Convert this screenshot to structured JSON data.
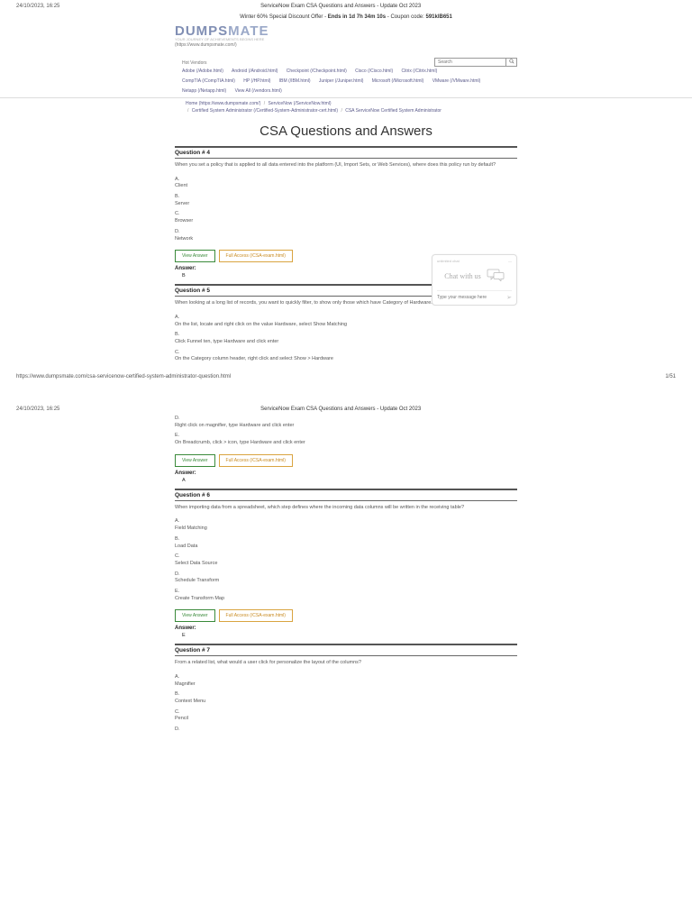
{
  "meta": {
    "datetime": "24/10/2023, 16:25",
    "docTitle": "ServiceNow Exam CSA Questions and Answers - Update Oct 2023",
    "footerUrl": "https://www.dumpsmate.com/csa-servicenow-certified-system-administrator-question.html",
    "footerPage": "1/51"
  },
  "promo": {
    "prefix": "Winter 60% Special Discount Offer - ",
    "endsLabel": "Ends in",
    "countdown": "1d 7h 34m 10s",
    "couponLabel": " - Coupon code: ",
    "coupon": "591klB651"
  },
  "brand": {
    "name1": "DUMPS",
    "name2": "MATE",
    "tagline": "YOUR JOURNEY OF ACHIEVEMENTS BEGINS HERE",
    "url": "(https://www.dumpsmate.com/)"
  },
  "search": {
    "placeholder": "Search"
  },
  "hotVendorsLabel": "Hot Vendors",
  "vendors": {
    "row1": [
      "Adobe (/Adobe.html)",
      "Android (/Android.html)",
      "Checkpoint (/Checkpoint.html)",
      "Cisco (/Cisco.html)",
      "Citrix (/Citrix.html)"
    ],
    "row2": [
      "CompTIA (/CompTIA.html)",
      "HP (/HP.html)",
      "IBM (/IBM.html)",
      "Juniper (/Juniper.html)",
      "Microsoft (/Microsoft.html)",
      "VMware (/VMware.html)"
    ],
    "row3": [
      "Netapp (/Netapp.html)",
      "View All (/vendors.html)"
    ]
  },
  "breadcrumbs": {
    "home": "Home (https://www.dumpsmate.com/)",
    "vendor": "ServiceNow (/ServiceNow.html)",
    "cert": "Certified System Administrator (/Certified-System-Administrator-cert.html)",
    "exam": "CSA ServiceNow Certified System Administrator"
  },
  "pageTitle": "CSA Questions and Answers",
  "chat": {
    "topLabel": "unlimited chat",
    "title": "Chat with us",
    "placeholder": "Type your message here"
  },
  "buttons": {
    "view": "View Answer",
    "full": "Full Access (/CSA-exam.html)"
  },
  "answerLabel": "Answer:",
  "q4": {
    "header": "Question # 4",
    "text": "When you set a policy that is applied to all data entered into the platform (UI, Import Sets, or Web Services), where does this policy run by default?",
    "a": "A.",
    "aText": "Client",
    "b": "B.",
    "bText": "Server",
    "c": "C.",
    "cText": "Browser",
    "d": "D.",
    "dText": "Network",
    "answer": "B"
  },
  "q5": {
    "header": "Question # 5",
    "text": "When looking at a long list of records, you want to quickly filter, to show only those which have Category of Hardware. How might you do that?",
    "a": "A.",
    "aText": "On the list, locate and right click on the value Hardware, select Show Matching",
    "b": "B.",
    "bText": "Click Funnel ten, type Hardware and click enter",
    "c": "C.",
    "cText": "On the Category column header, right click and select Show > Hardware",
    "d": "D.",
    "dText": "Right click on magnifier, type Hardware and click enter",
    "e": "E.",
    "eText": "On Breadcrumb, click > icon, type Hardware and click enter",
    "answer": "A"
  },
  "q6": {
    "header": "Question # 6",
    "text": "When importing data from a spreadsheet, which step defines where the incoming data columns will be written in the receiving table?",
    "a": "A.",
    "aText": "Field Matching",
    "b": "B.",
    "bText": "Load Data",
    "c": "C.",
    "cText": "Select Data Source",
    "d": "D.",
    "dText": "Schedule Transform",
    "e": "E.",
    "eText": "Create Transform Map",
    "answer": "E"
  },
  "q7": {
    "header": "Question # 7",
    "text": "From a related list, what would a user click for personalize the layout of the columns?",
    "a": "A.",
    "aText": "Magnifier",
    "b": "B.",
    "bText": "Context Menu",
    "c": "C.",
    "cText": "Pencil",
    "d": "D."
  }
}
